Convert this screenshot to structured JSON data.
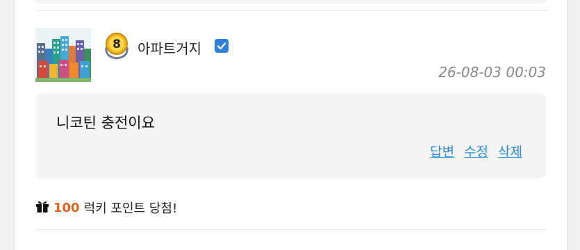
{
  "comment": {
    "author": "아파트거지",
    "level": "8",
    "timestamp": "26-08-03 00:03",
    "text": "니코틴 충전이요",
    "actions": {
      "reply": "답변",
      "edit": "수정",
      "delete": "삭제"
    }
  },
  "lucky": {
    "points": "100",
    "label": "럭키 포인트 당첨!"
  },
  "icons": {
    "badge": "level-badge-icon",
    "verified": "verified-check-icon",
    "gift": "gift-icon"
  },
  "colors": {
    "link": "#2a8bd6",
    "points": "#e0641c",
    "verified": "#2f80d8",
    "timestamp": "#888888"
  }
}
